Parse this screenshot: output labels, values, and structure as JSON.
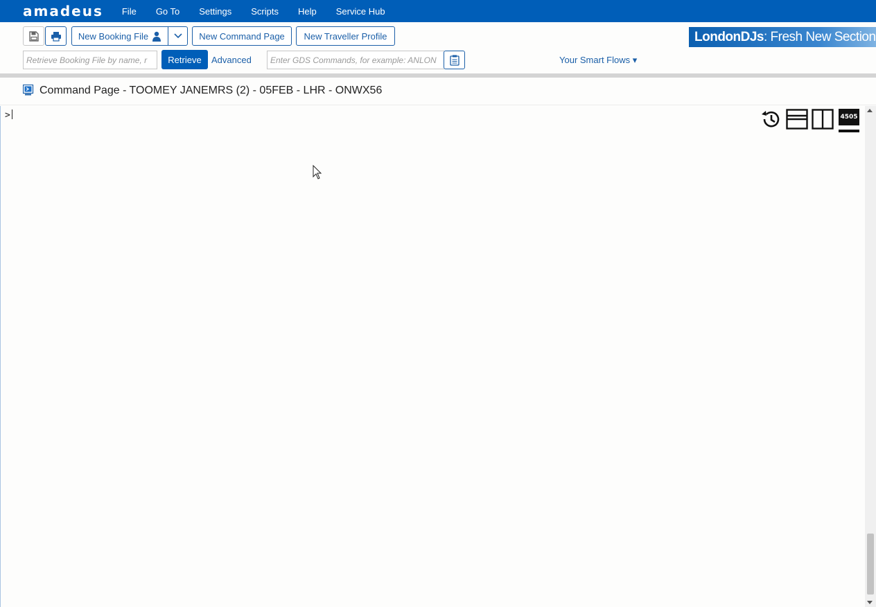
{
  "menubar": {
    "logo": "amadeus",
    "items": [
      "File",
      "Go To",
      "Settings",
      "Scripts",
      "Help",
      "Service Hub"
    ]
  },
  "toolbar": {
    "new_booking_file": "New Booking File",
    "new_command_page": "New Command Page",
    "new_traveller_profile": "New Traveller Profile",
    "retrieve_placeholder": "Retrieve Booking File by name, r",
    "retrieve_button": "Retrieve",
    "advanced_link": "Advanced",
    "gds_placeholder": "Enter GDS Commands, for example: ANLON",
    "smart_flows": "Your Smart Flows ▾",
    "banner_bold": "LondonDJs",
    "banner_light": " : Fresh New Section"
  },
  "page": {
    "title": "Command Page - TOOMEY JANEMRS (2) - 05FEB - LHR - ONWX56"
  },
  "command": {
    "prompt": ">"
  },
  "tools": {
    "badge": "4505"
  },
  "colors": {
    "brand": "#005eb8",
    "link": "#1b5fa8"
  }
}
